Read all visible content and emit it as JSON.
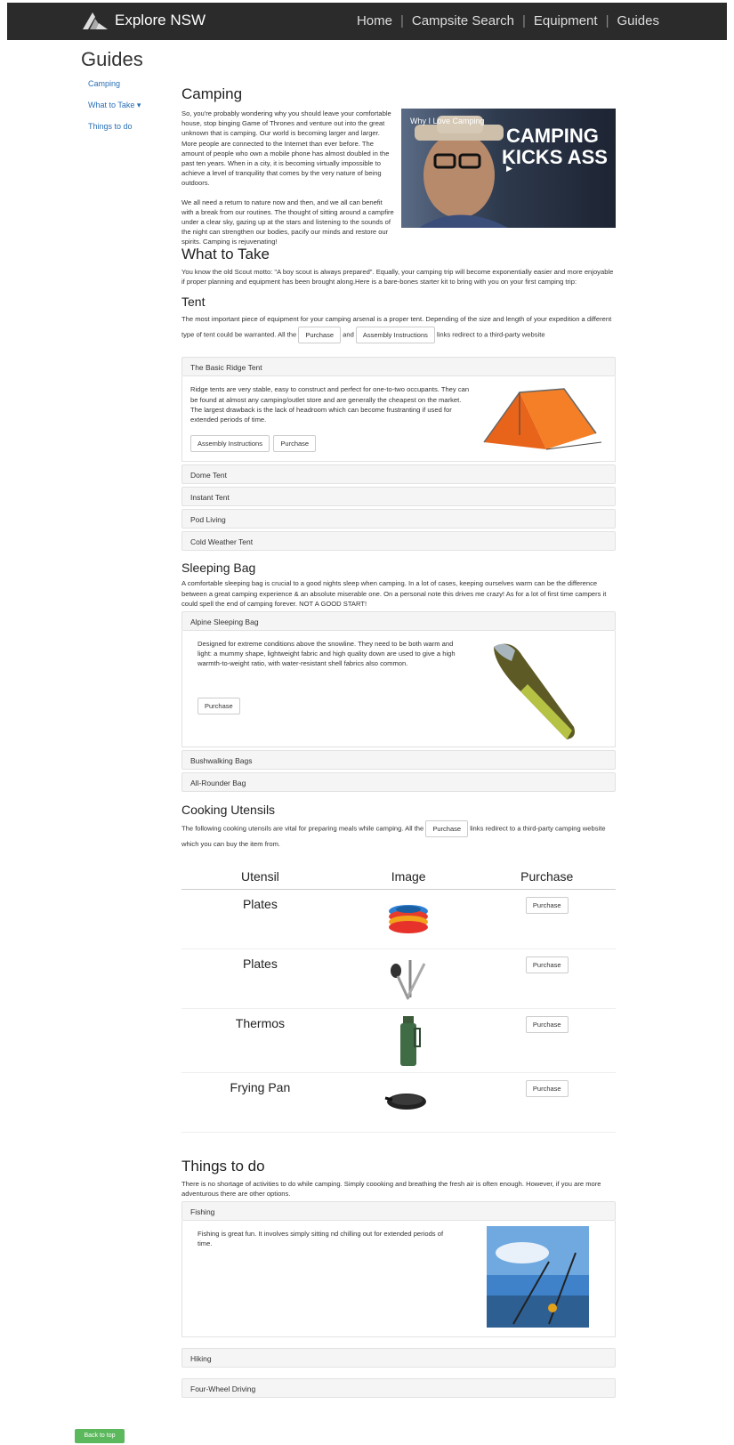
{
  "nav": {
    "brand": "Explore NSW",
    "links": [
      "Home",
      "Campsite Search",
      "Equipment",
      "Guides"
    ]
  },
  "page_title": "Guides",
  "sidenav": [
    "Camping",
    "What to Take ▾",
    "Things to do"
  ],
  "camping": {
    "title": "Camping",
    "p1": "So, you're probably wondering why you should leave your comfortable house, stop binging Game of Thrones and venture out into the great unknown that is camping. Our world is becoming larger and larger. More people are connected to the Internet than ever before. The amount of people who own a mobile phone has almost doubled in the past ten years. When in a city, it is becoming virtually impossible to achieve a level of tranquility that comes by the very nature of being outdoors.",
    "p2": "We all need a return to nature now and then, and we all can benefit with a break from our routines. The thought of sitting around a campfire under a clear sky, gazing up at the stars and listening to the sounds of the night can strengthen our bodies, pacify our minds and restore our spirits. Camping is rejuvenating!",
    "video_title": "Why I Love Camping",
    "video_overlay_1": "CAMPING",
    "video_overlay_2": "KICKS ASS"
  },
  "what_to_take": {
    "title": "What to Take",
    "intro": "You know the old Scout motto: \"A boy scout is always prepared\". Equally, your camping trip will become exponentially easier and more enjoyable if proper planning and equipment has been brought along.Here is a bare-bones starter kit to bring with you on your first camping trip:"
  },
  "tent": {
    "title": "Tent",
    "text_a": "The most important piece of equipment for your camping arsenal is a proper tent. Depending of the size and length of your expedition a different type of tent could be warranted. All the",
    "btn_purchase": "Purchase",
    "and": "and",
    "btn_assembly": "Assembly Instructions",
    "text_b": "links redirect to a third-party website",
    "panels": [
      "The Basic Ridge Tent",
      "Dome Tent",
      "Instant Tent",
      "Pod Living",
      "Cold Weather Tent"
    ],
    "ridge_text": "Ridge tents are very stable, easy to construct and perfect for one-to-two occupants. They can be found at almost any camping/outlet store and are generally the cheapest on the market. The largest drawback is the lack of headroom which can become frustranting if used for extended periods of time.",
    "ridge_btn_assembly": "Assembly Instructions",
    "ridge_btn_purchase": "Purchase"
  },
  "sleeping": {
    "title": "Sleeping Bag",
    "intro": "A comfortable sleeping bag is crucial to a good nights sleep when camping. In a lot of cases, keeping ourselves warm can be the difference between a great camping experience & an absolute miserable one. On a personal note this drives me crazy! As for a lot of first time campers it could spell the end of camping forever. NOT A GOOD START!",
    "panels": [
      "Alpine Sleeping Bag",
      "Bushwalking Bags",
      "All-Rounder Bag"
    ],
    "alpine_text": "Designed for extreme conditions above the snowline. They need to be both warm and light: a mummy shape, lightweight fabric and high quality down are used to give a high warmth-to-weight ratio, with water-resistant shell fabrics also common.",
    "alpine_btn": "Purchase"
  },
  "cooking": {
    "title": "Cooking Utensils",
    "text_a": "The following cooking utensils are vital for preparing meals while camping. All the",
    "btn": "Purchase",
    "text_b": "links redirect to a third-party camping website which you can buy the item from.",
    "headers": [
      "Utensil",
      "Image",
      "Purchase"
    ],
    "rows": [
      {
        "name": "Plates",
        "icon": "plates-icon",
        "btn": "Purchase"
      },
      {
        "name": "Plates",
        "icon": "cutlery-icon",
        "btn": "Purchase"
      },
      {
        "name": "Thermos",
        "icon": "thermos-icon",
        "btn": "Purchase"
      },
      {
        "name": "Frying Pan",
        "icon": "frying-pan-icon",
        "btn": "Purchase"
      }
    ]
  },
  "things": {
    "title": "Things to do",
    "intro": "There is no shortage of activities to do while camping. Simply coooking and breathing the fresh air is often enough. However, if you are more adventurous there are other options.",
    "panels": [
      "Fishing",
      "Hiking",
      "Four-Wheel Driving"
    ],
    "fishing_text": "Fishing is great fun. It involves simply sitting nd chilling out for extended periods of time."
  },
  "back_to_top": "Back to top"
}
